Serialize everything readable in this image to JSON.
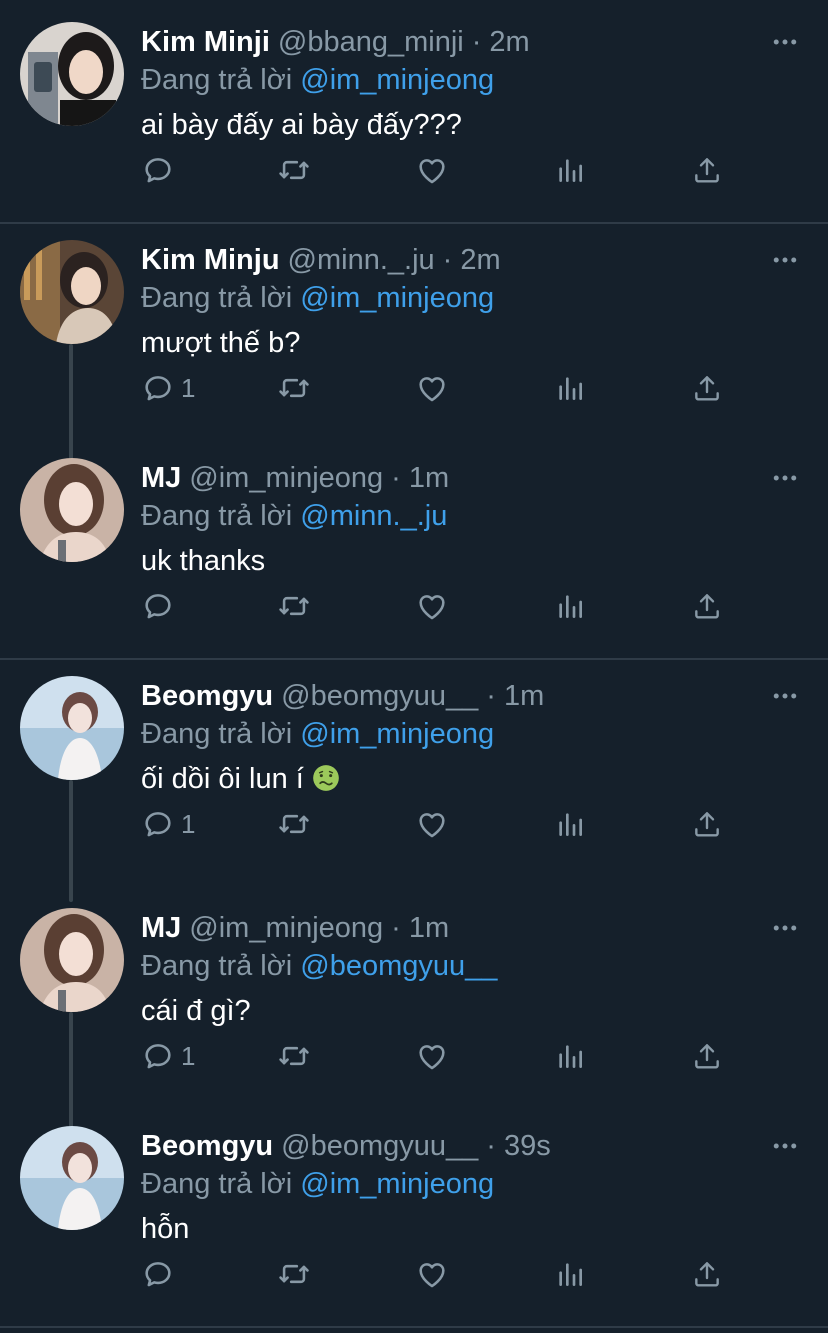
{
  "reply_prefix": "Đang trả lời",
  "colors": {
    "background": "#15202b",
    "divider": "#2f3b47",
    "secondary_text": "#8899a6",
    "mention": "#3fa0ea",
    "text": "#ffffff"
  },
  "icons": {
    "reply": "reply-icon",
    "retweet": "retweet-icon",
    "like": "like-icon",
    "analytics": "analytics-icon",
    "share": "share-icon",
    "more": "more-icon"
  },
  "tweets": [
    {
      "name": "Kim Minji",
      "handle": "@bbang_minji",
      "separator": "·",
      "time": "2m",
      "reply_to": "@im_minjeong",
      "text": "ai bày đấy ai bày đấy???",
      "reply_count": ""
    },
    {
      "name": "Kim Minju",
      "handle": "@minn._.ju",
      "separator": "·",
      "time": "2m",
      "reply_to": "@im_minjeong",
      "text": "mượt thế b?",
      "reply_count": "1"
    },
    {
      "name": "MJ",
      "handle": "@im_minjeong",
      "separator": "·",
      "time": "1m",
      "reply_to": "@minn._.ju",
      "text": "uk thanks",
      "reply_count": ""
    },
    {
      "name": "Beomgyu",
      "handle": "@beomgyuu__",
      "separator": "·",
      "time": "1m",
      "reply_to": "@im_minjeong",
      "text": "ối dồi ôi lun í",
      "emoji": "nauseated-face-emoji",
      "reply_count": "1"
    },
    {
      "name": "MJ",
      "handle": "@im_minjeong",
      "separator": "·",
      "time": "1m",
      "reply_to": "@beomgyuu__",
      "text": "cái đ gì?",
      "reply_count": "1"
    },
    {
      "name": "Beomgyu",
      "handle": "@beomgyuu__",
      "separator": "·",
      "time": "39s",
      "reply_to": "@im_minjeong",
      "text": "hỗn",
      "reply_count": ""
    }
  ]
}
